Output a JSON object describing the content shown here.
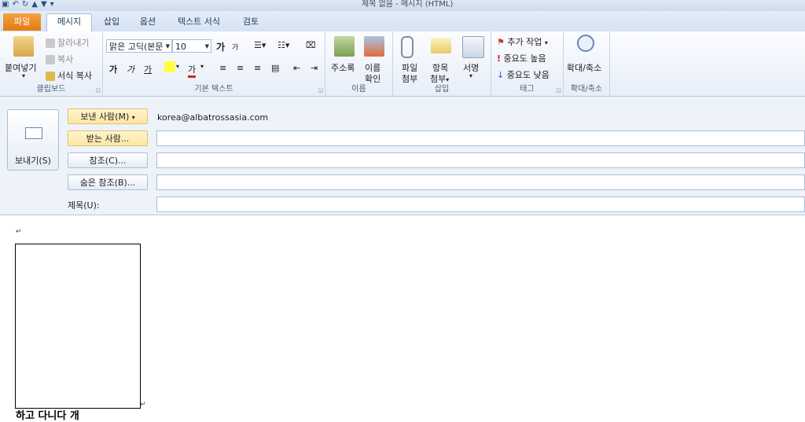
{
  "window": {
    "title": "제목 없음 - 메시지 (HTML)"
  },
  "tabs": {
    "file": "파일",
    "message": "메시지",
    "insert": "삽입",
    "options": "옵션",
    "format_text": "텍스트 서식",
    "review": "검토"
  },
  "clipboard": {
    "paste": "붙여넣기",
    "cut": "잘라내기",
    "copy": "복사",
    "format_painter": "서식 복사",
    "label": "클립보드"
  },
  "basic_text": {
    "font": "맑은 고딕(본문",
    "size": "10",
    "label": "기본 텍스트",
    "grow": "가",
    "shrink": "가",
    "bold": "가",
    "italic": "가",
    "underline": "가"
  },
  "names": {
    "address_book": "주소록",
    "check_names_1": "이름",
    "check_names_2": "확인",
    "label": "이름"
  },
  "insert": {
    "attach_file_1": "파일",
    "attach_file_2": "첨부",
    "attach_item_1": "항목",
    "attach_item_2": "첨부",
    "signature": "서명",
    "label": "삽입"
  },
  "tags": {
    "follow_up": "추가 작업",
    "high_importance": "중요도 높음",
    "low_importance": "중요도 낮음",
    "label": "태그"
  },
  "zoom": {
    "zoom": "확대/축소",
    "label": "확대/축소"
  },
  "compose": {
    "send": "보내기(S)",
    "from_button": "보낸 사람(M)",
    "from_value": "korea@albatrossasia.com",
    "to_button": "받는 사람...",
    "cc_button": "참조(C)...",
    "bcc_button": "숨은 참조(B)...",
    "subject_label": "제목(U):"
  },
  "body": {
    "partial_text": "하고 다니다 개"
  }
}
